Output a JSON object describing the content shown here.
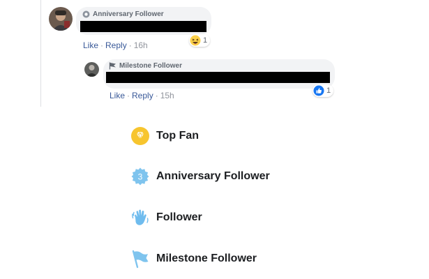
{
  "comments": [
    {
      "badge": "Anniversary Follower",
      "badge_icon": "anniversary-mini-icon",
      "actions": {
        "like": "Like",
        "reply": "Reply",
        "time": "16h",
        "separator": "·"
      },
      "reaction": {
        "icon": "laughing-emoji-icon",
        "count": "1"
      }
    },
    {
      "badge": "Milestone Follower",
      "badge_icon": "flag-mini-icon",
      "actions": {
        "like": "Like",
        "reply": "Reply",
        "time": "15h",
        "separator": "·"
      },
      "reaction": {
        "icon": "thumbs-up-icon",
        "count": "1"
      }
    }
  ],
  "legend": [
    {
      "label": "Top Fan",
      "icon": "diamond-badge-icon",
      "color": "#f7c52e"
    },
    {
      "label": "Anniversary Follower",
      "icon": "anniversary-3-icon",
      "color": "#7fc4ee"
    },
    {
      "label": "Follower",
      "icon": "waving-hand-icon",
      "color": "#6fbcee"
    },
    {
      "label": "Milestone Follower",
      "icon": "milestone-flag-icon",
      "color": "#7fc4ee"
    }
  ],
  "colors": {
    "link": "#385898",
    "bubble": "#f2f3f5",
    "like_blue": "#1877f2"
  }
}
